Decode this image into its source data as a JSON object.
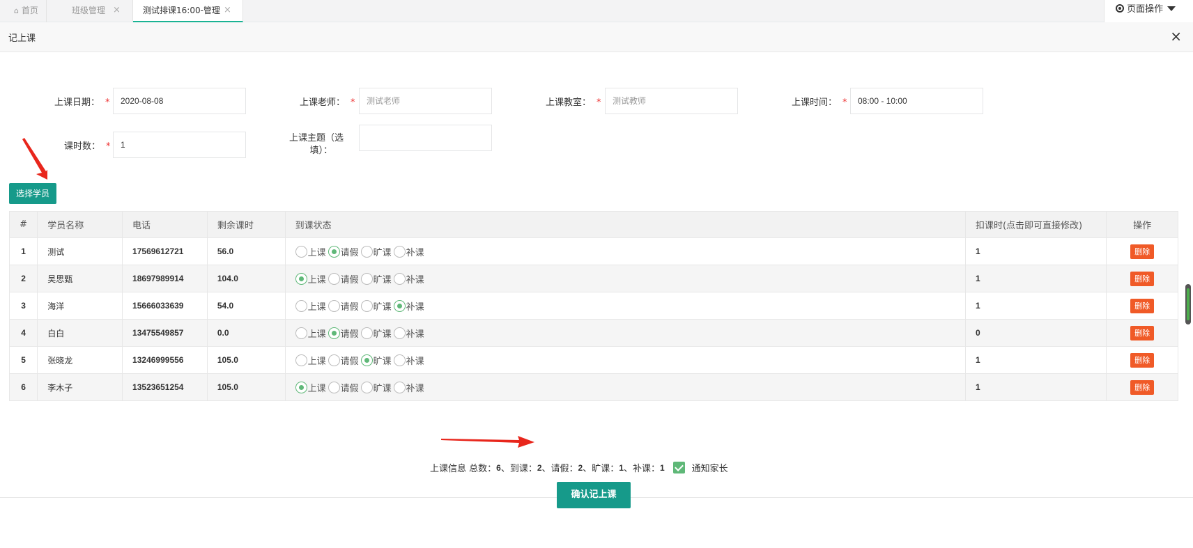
{
  "tabs": {
    "home": "首页",
    "class_mgmt": "班级管理",
    "active": "测试排课16:00-管理",
    "close": "×",
    "page_ops": "页面操作"
  },
  "modal": {
    "title": "记上课",
    "close": "×"
  },
  "form": {
    "date_label": "上课日期：",
    "date_value": "2020-08-08",
    "teacher_label": "上课老师：",
    "teacher_value": "测试老师",
    "room_label": "上课教室：",
    "room_value": "测试教师",
    "time_label": "上课时间：",
    "time_value": "08:00 - 10:00",
    "hours_label": "课时数：",
    "hours_value": "1",
    "topic_label_1": "上课主题（选",
    "topic_label_2": "填）：",
    "topic_value": "",
    "required": "*"
  },
  "select_button": "选择学员",
  "table": {
    "headers": [
      "#",
      "学员名称",
      "电话",
      "剩余课时",
      "到课状态",
      "扣课时(点击即可直接修改)",
      "操作"
    ],
    "status_options": [
      "上课",
      "请假",
      "旷课",
      "补课"
    ],
    "delete_label": "删除",
    "rows": [
      {
        "idx": "1",
        "name": "测试",
        "phone": "17569612721",
        "remaining": "56.0",
        "status": 1,
        "deduct": "1"
      },
      {
        "idx": "2",
        "name": "吴思甄",
        "phone": "18697989914",
        "remaining": "104.0",
        "status": 0,
        "deduct": "1"
      },
      {
        "idx": "3",
        "name": "海洋",
        "phone": "15666033639",
        "remaining": "54.0",
        "status": 3,
        "deduct": "1"
      },
      {
        "idx": "4",
        "name": "白白",
        "phone": "13475549857",
        "remaining": "0.0",
        "status": 1,
        "deduct": "0"
      },
      {
        "idx": "5",
        "name": "张晓龙",
        "phone": "13246999556",
        "remaining": "105.0",
        "status": 2,
        "deduct": "1"
      },
      {
        "idx": "6",
        "name": "李木子",
        "phone": "13523651254",
        "remaining": "105.0",
        "status": 0,
        "deduct": "1"
      }
    ]
  },
  "summary": {
    "prefix": "上课信息 总数：",
    "total": "6",
    "sep_attend": "、到课：",
    "attend": "2",
    "sep_leave": "、请假：",
    "leave": "2",
    "sep_absent": "、旷课：",
    "absent": "1",
    "sep_makeup": "、补课：",
    "makeup": "1",
    "notify_parent": "通知家长"
  },
  "confirm_button": "确认记上课",
  "colors": {
    "primary": "#169a8a",
    "danger": "#f05a27",
    "radio_on": "#5fb878",
    "required": "#e33333",
    "annotation_arrow": "#e8261c"
  },
  "icons": {
    "home": "home-icon",
    "page_ops": "target-circle-icon",
    "dropdown": "caret-down-icon"
  }
}
